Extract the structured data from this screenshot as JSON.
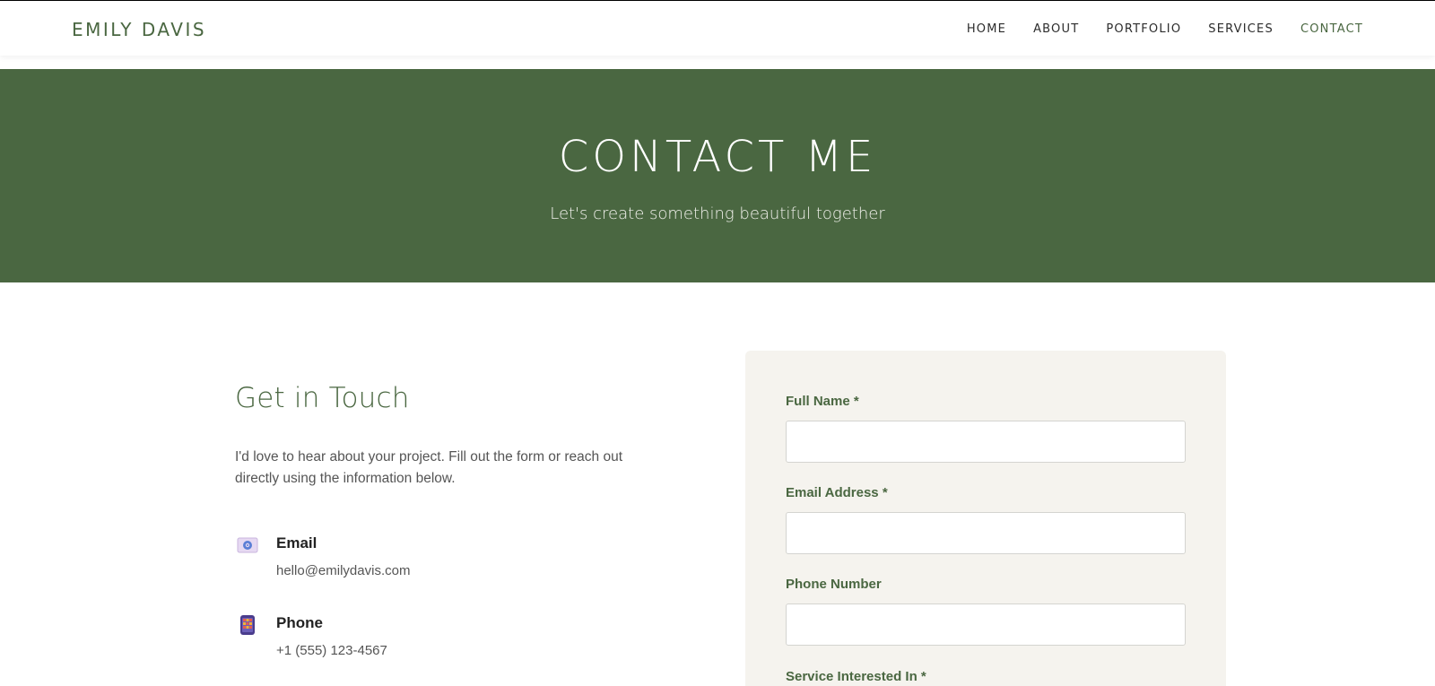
{
  "header": {
    "brand": "EMILY DAVIS",
    "nav": [
      {
        "label": "HOME"
      },
      {
        "label": "ABOUT"
      },
      {
        "label": "PORTFOLIO"
      },
      {
        "label": "SERVICES"
      },
      {
        "label": "CONTACT",
        "active": true
      }
    ]
  },
  "hero": {
    "title": "CONTACT ME",
    "subtitle": "Let's create something beautiful together"
  },
  "info": {
    "title": "Get in Touch",
    "description": "I'd love to hear about your project. Fill out the form or reach out directly using the information below.",
    "items": [
      {
        "icon": "email-icon",
        "label": "Email",
        "value": "hello@emilydavis.com"
      },
      {
        "icon": "phone-icon",
        "label": "Phone",
        "value": "+1 (555) 123-4567"
      }
    ]
  },
  "form": {
    "full_name": {
      "label": "Full Name *",
      "value": "",
      "placeholder": ""
    },
    "email": {
      "label": "Email Address *",
      "value": "",
      "placeholder": ""
    },
    "phone": {
      "label": "Phone Number",
      "value": "",
      "placeholder": ""
    },
    "service": {
      "label": "Service Interested In *"
    }
  },
  "colors": {
    "brand_green": "#4a6741",
    "form_background": "#f5f3ee"
  }
}
